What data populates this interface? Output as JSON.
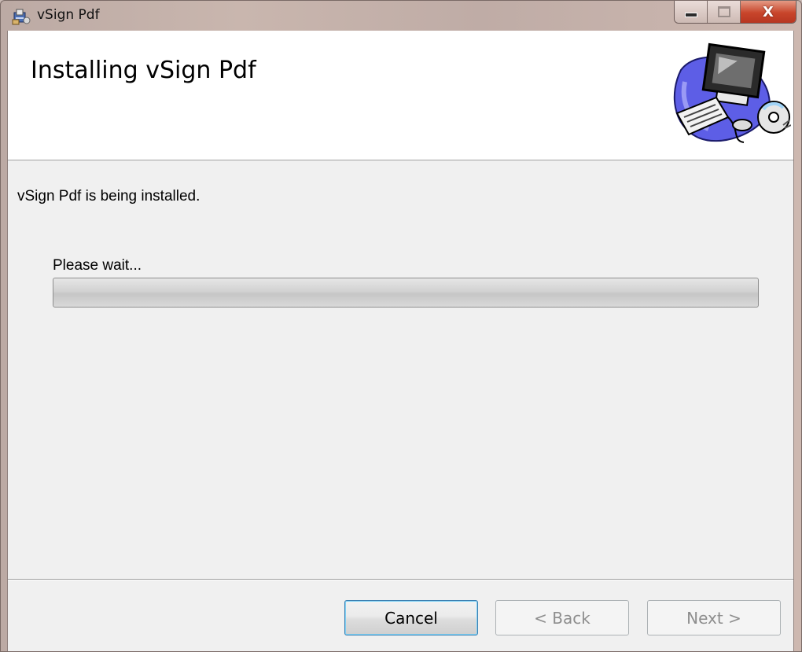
{
  "window": {
    "title": "vSign Pdf",
    "close_glyph": "X"
  },
  "banner": {
    "title": "Installing vSign Pdf",
    "art_icon": "computer-cd-icon"
  },
  "main": {
    "status_text": "vSign Pdf is being installed.",
    "wait_text": "Please wait...",
    "progress": 0
  },
  "buttons": {
    "cancel": "Cancel",
    "back": "< Back",
    "next": "Next >"
  },
  "colors": {
    "progress_fill": "#37b51d",
    "close_button": "#c8452b",
    "focus_border": "#3c7fb1"
  }
}
